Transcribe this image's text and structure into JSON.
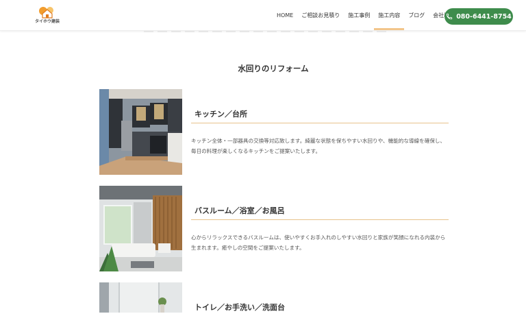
{
  "header": {
    "logo_text": "タイホウ建装",
    "nav": [
      "HOME",
      "ご相談お見積り",
      "施工事例",
      "施工内容",
      "ブログ",
      "会社概要"
    ],
    "active_nav": "施工内容",
    "phone": "080-6441-8754",
    "accent_color": "#3e8c4c"
  },
  "main": {
    "title": "水回りのリフォーム",
    "items": [
      {
        "title": "キッチン／台所",
        "desc": "キッチン全体・一部器具の交換等対応致します。綺麗な状態を保ちやすい水回りや、機能的な導線を確保し、毎日の料理が楽しくなるキッチンをご提案いたします。"
      },
      {
        "title": "バスルーム／浴室／お風呂",
        "desc": "心からリラックスできるバスルームは、使いやすくお手入れのしやすい水回りと家族が笑顔になれる内装から生まれます。癒やしの空間をご提案いたします。"
      },
      {
        "title": "トイレ／お手洗い／洗面台",
        "desc": ""
      }
    ]
  }
}
